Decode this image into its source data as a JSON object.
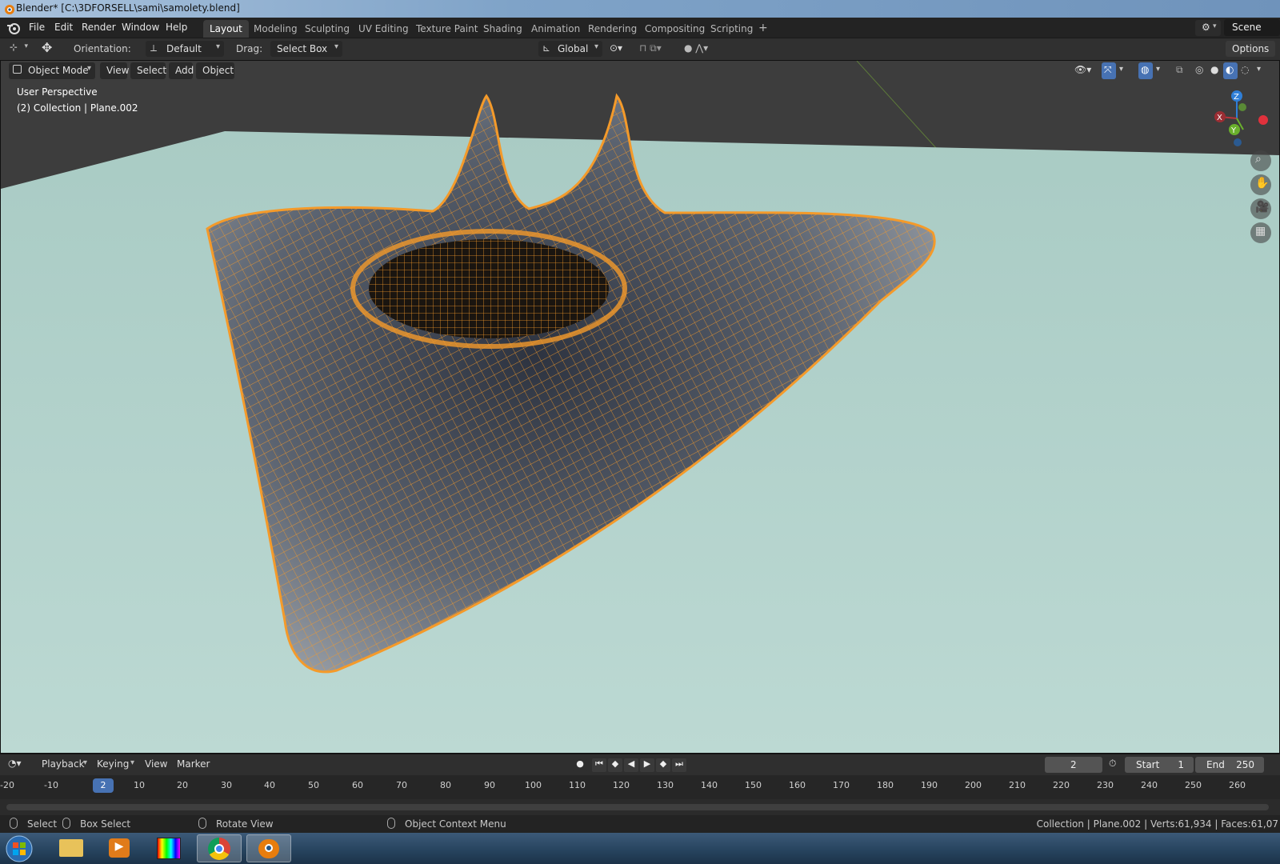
{
  "window": {
    "title": "Blender* [C:\\3DFORSELL\\sami\\samolety.blend]"
  },
  "menu": [
    "File",
    "Edit",
    "Render",
    "Window",
    "Help"
  ],
  "workspaces": [
    "Layout",
    "Modeling",
    "Sculpting",
    "UV Editing",
    "Texture Paint",
    "Shading",
    "Animation",
    "Rendering",
    "Compositing",
    "Scripting"
  ],
  "active_workspace": "Layout",
  "scene_label": "Scene",
  "tool_header": {
    "orientation_label": "Orientation:",
    "orientation_value": "Default",
    "drag_label": "Drag:",
    "drag_value": "Select Box",
    "transform_orientation": "Global",
    "options_label": "Options"
  },
  "viewport_header": {
    "mode": "Object Mode",
    "menus": [
      "View",
      "Select",
      "Add",
      "Object"
    ]
  },
  "viewport": {
    "perspective": "User Perspective",
    "collection_info": "(2) Collection | Plane.002",
    "selection_color": "#f49a2a",
    "floor_color": "#b8d6d0"
  },
  "gizmo": {
    "z": "Z",
    "y": "Y",
    "x": "X"
  },
  "timeline": {
    "menus": [
      "Playback",
      "Keying",
      "View",
      "Marker"
    ],
    "current_frame": "2",
    "start_label": "Start",
    "start_value": "1",
    "end_label": "End",
    "end_value": "250",
    "ticks": [
      "-20",
      "-10",
      "10",
      "20",
      "30",
      "40",
      "50",
      "60",
      "70",
      "80",
      "90",
      "100",
      "110",
      "120",
      "130",
      "140",
      "150",
      "160",
      "170",
      "180",
      "190",
      "200",
      "210",
      "220",
      "230",
      "240",
      "250",
      "260"
    ],
    "playhead_label": "2"
  },
  "statusbar": {
    "select": "Select",
    "box_select": "Box Select",
    "rotate_view": "Rotate View",
    "context_menu": "Object Context Menu",
    "stats": "Collection | Plane.002 | Verts:61,934 | Faces:61,07"
  }
}
